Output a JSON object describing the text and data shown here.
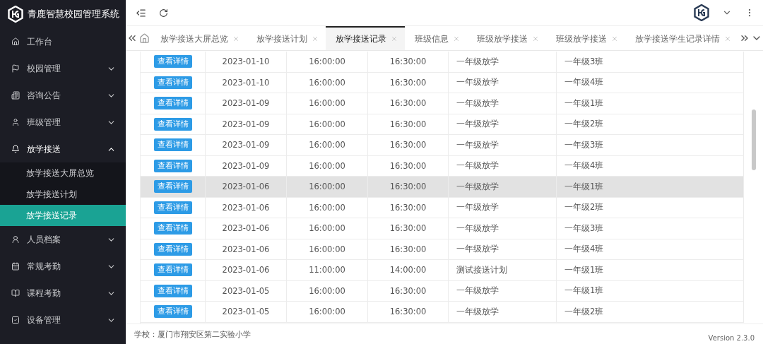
{
  "app": {
    "title": "青鹿智慧校园管理系统"
  },
  "sidebar": {
    "items": [
      {
        "label": "工作台"
      },
      {
        "label": "校园管理",
        "expanded": false
      },
      {
        "label": "咨询公告",
        "expanded": false
      },
      {
        "label": "班级管理",
        "expanded": false
      },
      {
        "label": "放学接送",
        "expanded": true,
        "children": [
          {
            "label": "放学接送大屏总览",
            "selected": false
          },
          {
            "label": "放学接送计划",
            "selected": false
          },
          {
            "label": "放学接送记录",
            "selected": true
          }
        ]
      },
      {
        "label": "人员档案",
        "expanded": false
      },
      {
        "label": "常规考勤",
        "expanded": false
      },
      {
        "label": "课程考勤",
        "expanded": false
      },
      {
        "label": "设备管理",
        "expanded": false
      }
    ]
  },
  "tabs": [
    {
      "label": "放学接送大屏总览",
      "selected": false
    },
    {
      "label": "放学接送计划",
      "selected": false
    },
    {
      "label": "放学接送记录",
      "selected": true
    },
    {
      "label": "班级信息",
      "selected": false
    },
    {
      "label": "班级放学接送",
      "selected": false
    },
    {
      "label": "班级放学接送",
      "selected": false
    },
    {
      "label": "放学接送学生记录详情",
      "selected": false
    }
  ],
  "table": {
    "rows": [
      {
        "action": "查看详情",
        "date": "2023-01-10",
        "start": "16:00:00",
        "end": "16:30:00",
        "plan": "一年级放学",
        "class": "一年级3班",
        "hovered": false
      },
      {
        "action": "查看详情",
        "date": "2023-01-10",
        "start": "16:00:00",
        "end": "16:30:00",
        "plan": "一年级放学",
        "class": "一年级4班",
        "hovered": false
      },
      {
        "action": "查看详情",
        "date": "2023-01-09",
        "start": "16:00:00",
        "end": "16:30:00",
        "plan": "一年级放学",
        "class": "一年级1班",
        "hovered": false
      },
      {
        "action": "查看详情",
        "date": "2023-01-09",
        "start": "16:00:00",
        "end": "16:30:00",
        "plan": "一年级放学",
        "class": "一年级2班",
        "hovered": false
      },
      {
        "action": "查看详情",
        "date": "2023-01-09",
        "start": "16:00:00",
        "end": "16:30:00",
        "plan": "一年级放学",
        "class": "一年级3班",
        "hovered": false
      },
      {
        "action": "查看详情",
        "date": "2023-01-09",
        "start": "16:00:00",
        "end": "16:30:00",
        "plan": "一年级放学",
        "class": "一年级4班",
        "hovered": false
      },
      {
        "action": "查看详情",
        "date": "2023-01-06",
        "start": "16:00:00",
        "end": "16:30:00",
        "plan": "一年级放学",
        "class": "一年级1班",
        "hovered": true
      },
      {
        "action": "查看详情",
        "date": "2023-01-06",
        "start": "16:00:00",
        "end": "16:30:00",
        "plan": "一年级放学",
        "class": "一年级2班",
        "hovered": false
      },
      {
        "action": "查看详情",
        "date": "2023-01-06",
        "start": "16:00:00",
        "end": "16:30:00",
        "plan": "一年级放学",
        "class": "一年级3班",
        "hovered": false
      },
      {
        "action": "查看详情",
        "date": "2023-01-06",
        "start": "16:00:00",
        "end": "16:30:00",
        "plan": "一年级放学",
        "class": "一年级4班",
        "hovered": false
      },
      {
        "action": "查看详情",
        "date": "2023-01-06",
        "start": "11:00:00",
        "end": "14:00:00",
        "plan": "测试接送计划",
        "class": "一年级1班",
        "hovered": false
      },
      {
        "action": "查看详情",
        "date": "2023-01-05",
        "start": "16:00:00",
        "end": "16:30:00",
        "plan": "一年级放学",
        "class": "一年级1班",
        "hovered": false
      },
      {
        "action": "查看详情",
        "date": "2023-01-05",
        "start": "16:00:00",
        "end": "16:30:00",
        "plan": "一年级放学",
        "class": "一年级2班",
        "hovered": false
      }
    ]
  },
  "footer": {
    "school": "学校：厦门市翔安区第二实验小学",
    "version": "Version 2.3.0"
  }
}
